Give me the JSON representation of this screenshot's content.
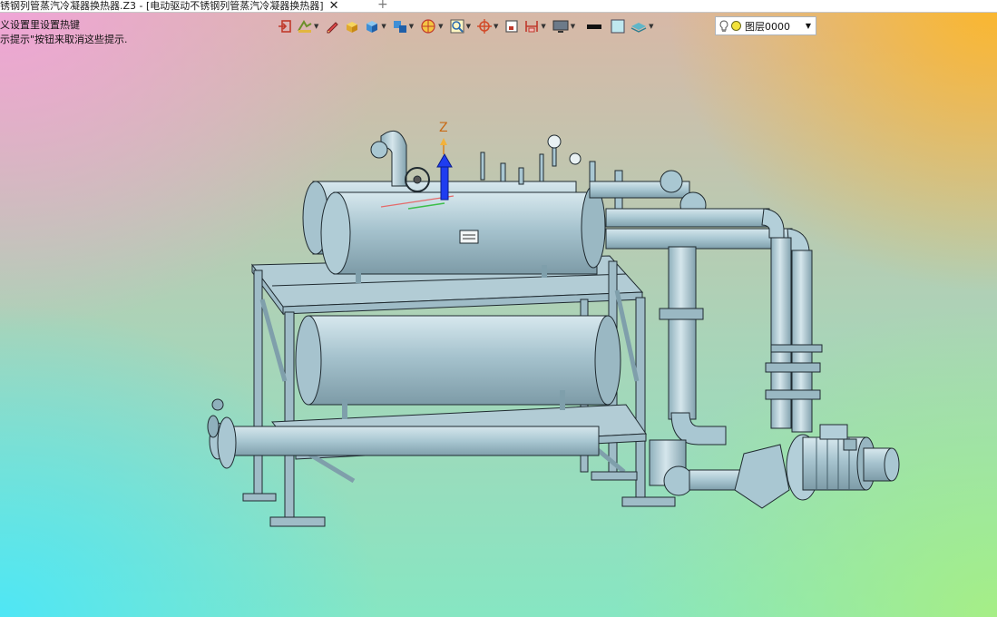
{
  "tab": {
    "title": "锈钢列管蒸汽冷凝器换热器.Z3 - [电动驱动不锈钢列管蒸汽冷凝器换热器]",
    "close": "✕",
    "add": "+"
  },
  "hints": {
    "line1": "义设置里设置热键",
    "line2": "示提示\"按钮来取消这些提示."
  },
  "layer": {
    "name": "图层0000"
  },
  "axis": {
    "z_label": "Z"
  },
  "colors": {
    "model_fill": "#a9c7d2",
    "model_edge": "#1f2a30",
    "axis_blue": "#1f3df0"
  }
}
